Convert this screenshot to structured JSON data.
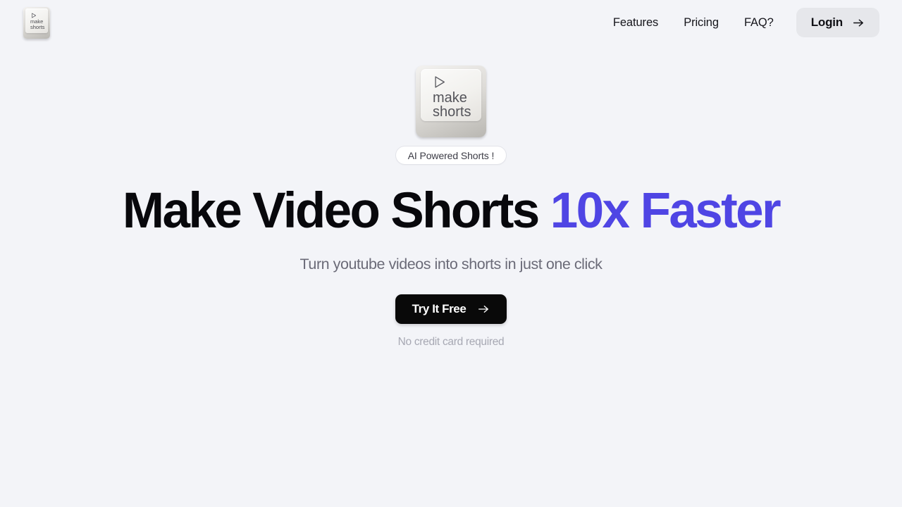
{
  "brand": {
    "keycap": {
      "icon": "play-triangle-icon",
      "line1": "make",
      "line2": "shorts"
    }
  },
  "nav": {
    "links": [
      {
        "label": "Features"
      },
      {
        "label": "Pricing"
      },
      {
        "label": "FAQ?"
      }
    ],
    "login": {
      "label": "Login",
      "icon": "arrow-right-icon"
    }
  },
  "hero": {
    "keycap": {
      "icon": "play-triangle-icon",
      "line1": "make",
      "line2": "shorts"
    },
    "badge": "AI Powered Shorts !",
    "headline": {
      "plain": "Make Video Shorts ",
      "accent": "10x Faster"
    },
    "subtitle": "Turn youtube videos into shorts in just one click",
    "cta": {
      "label": "Try It Free",
      "icon": "arrow-right-icon"
    },
    "fineprint": "No credit card required"
  },
  "colors": {
    "background": "#F3F4F8",
    "accent": "#4F45E4",
    "cta_background": "#090909",
    "login_background": "#E6E7EB",
    "text_primary": "#08080C",
    "text_muted": "#6B6B78",
    "text_light": "#A7A8B3"
  }
}
